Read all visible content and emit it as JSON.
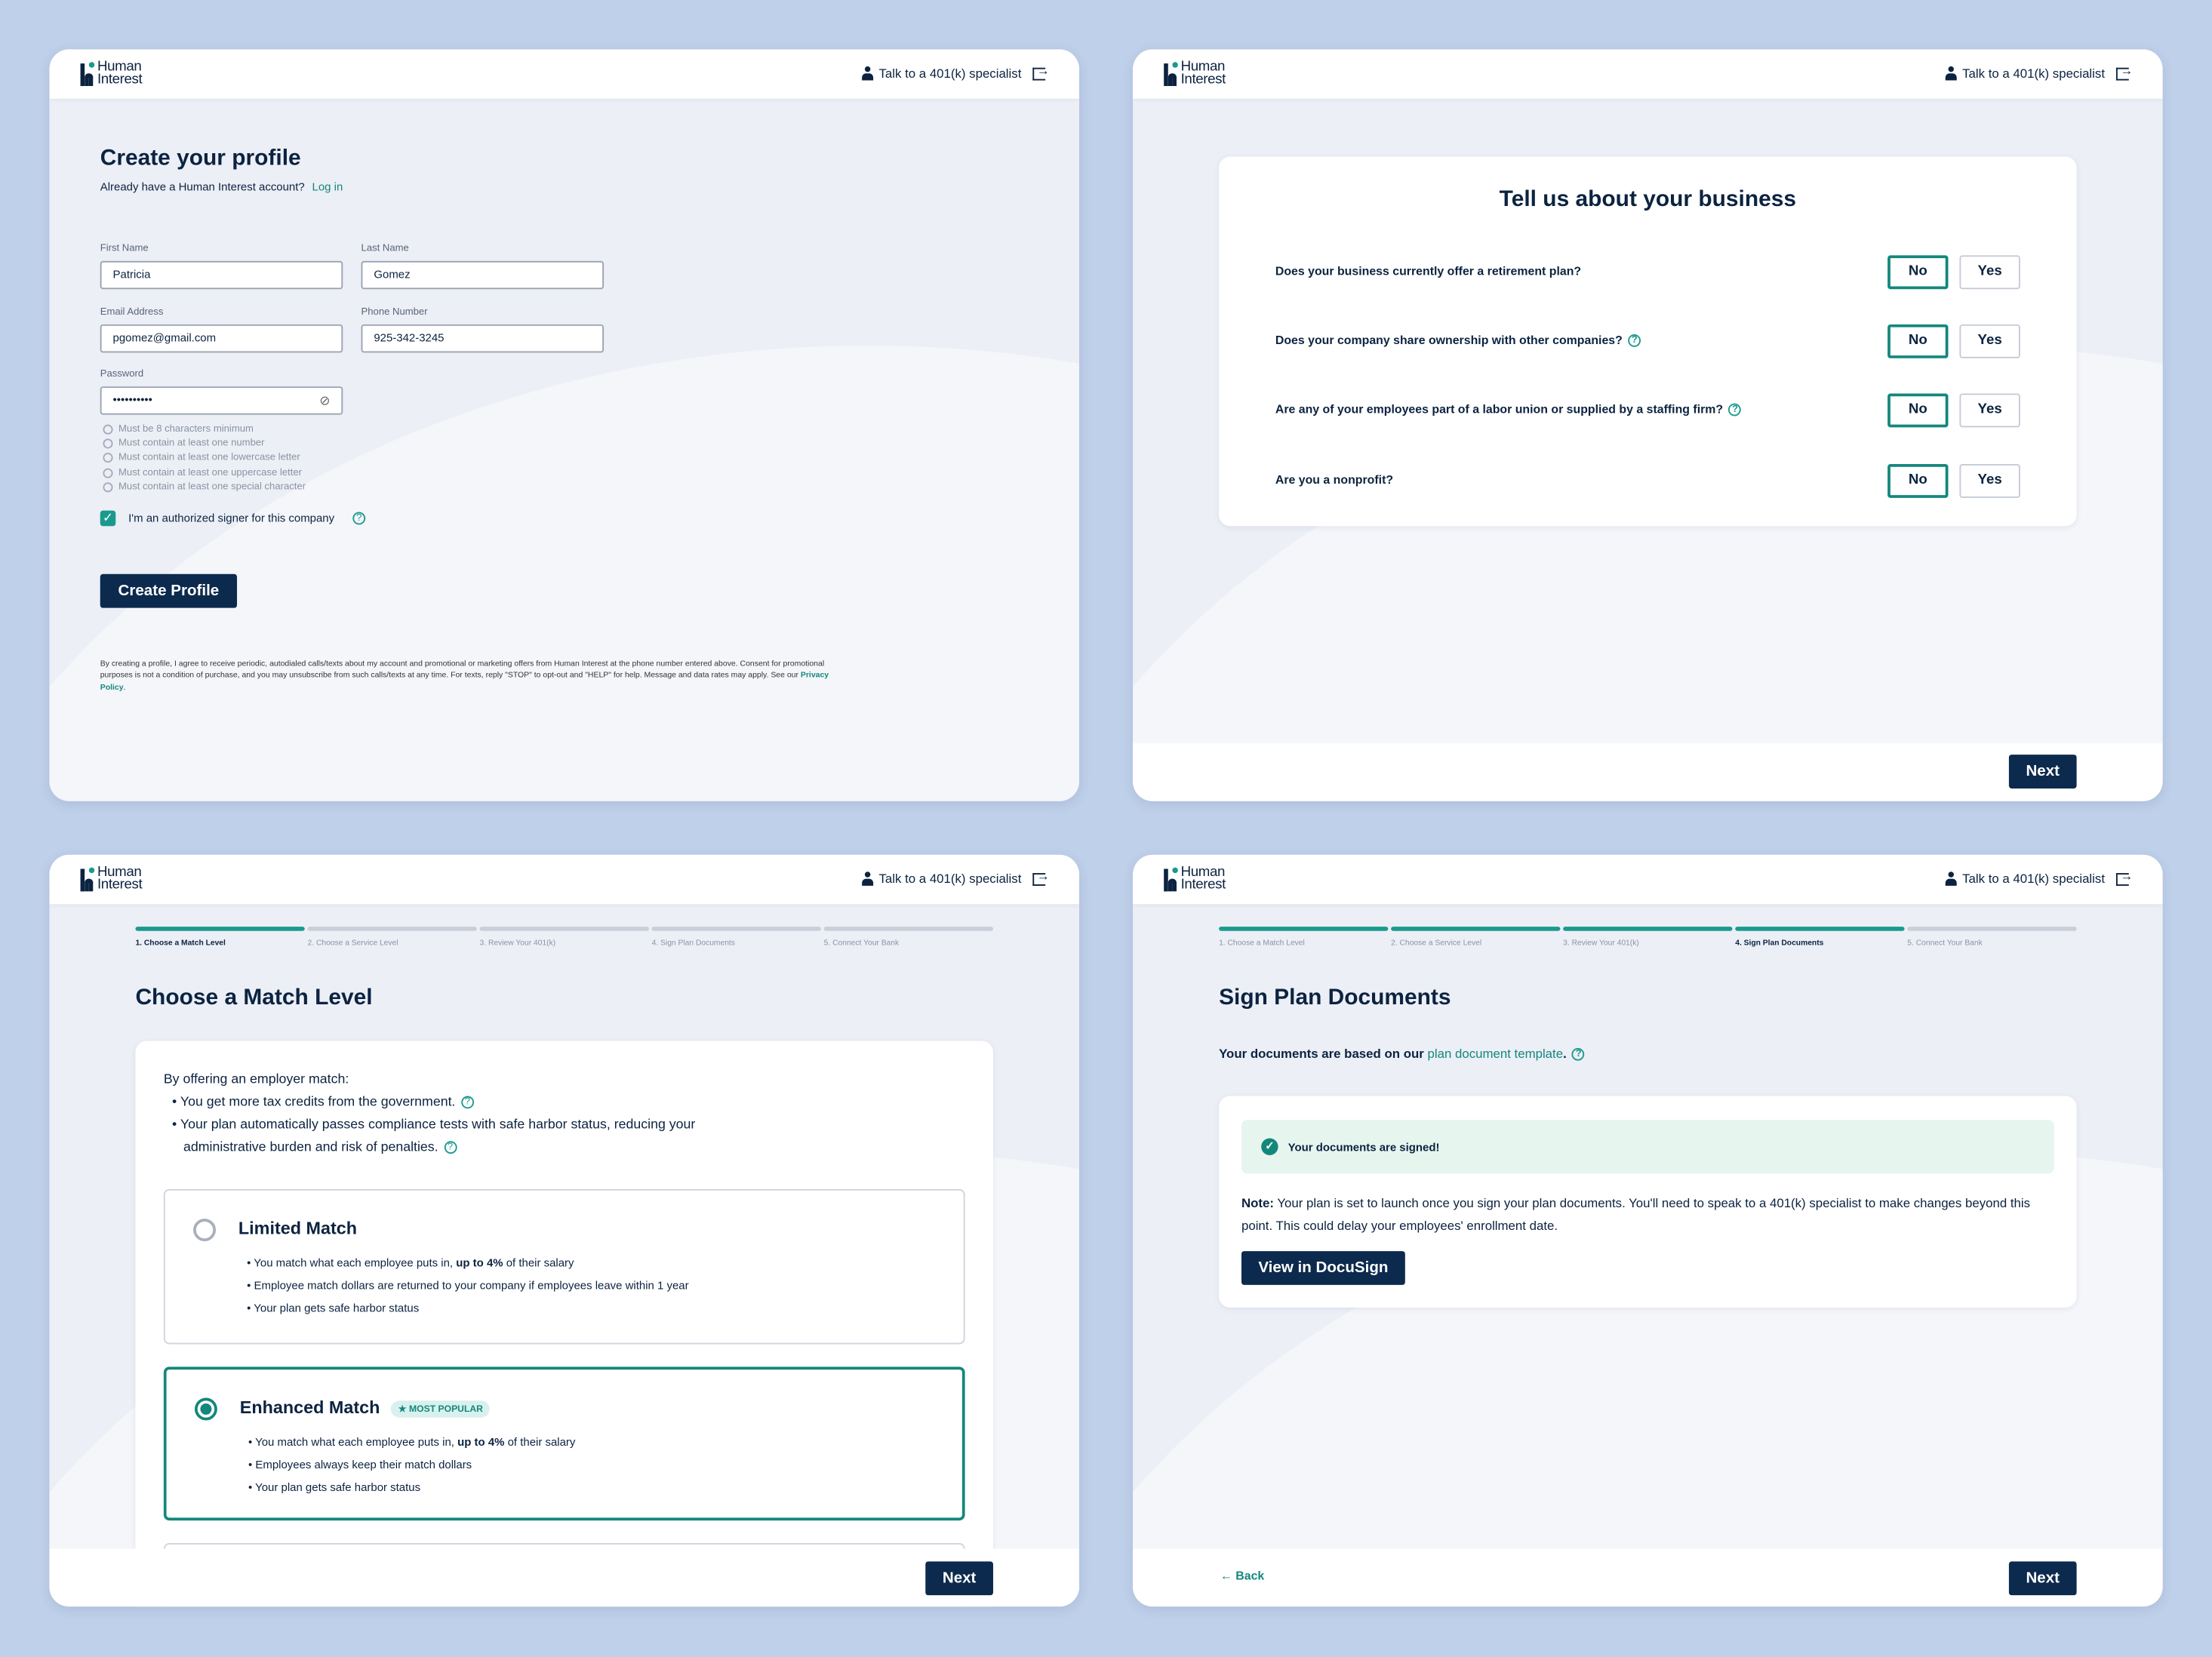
{
  "header": {
    "logo": "Human Interest",
    "specialist_link": "Talk to a 401(k) specialist"
  },
  "colors": {
    "navy": "#0c2a4d",
    "teal": "#14877c",
    "page_bg": "#bfd0ea"
  },
  "profile": {
    "title": "Create your profile",
    "subtitle": "Already have a Human Interest account?",
    "login_link": "Log in",
    "first_name_label": "First Name",
    "first_name": "Patricia",
    "last_name_label": "Last Name",
    "last_name": "Gomez",
    "email_label": "Email Address",
    "email": "pgomez@gmail.com",
    "phone_label": "Phone Number",
    "phone": "925-342-3245",
    "password_label": "Password",
    "password": "••••••••••",
    "rules": [
      "Must be 8 characters minimum",
      "Must contain at least one number",
      "Must contain at least one lowercase letter",
      "Must contain at least one uppercase letter",
      "Must contain at least one special character"
    ],
    "signer_label": "I'm an authorized signer for this company",
    "signer_checked": true,
    "submit": "Create Profile",
    "disclaimer": "By creating a profile, I agree to receive periodic, autodialed calls/texts about my account and promotional or marketing offers from Human Interest at the phone number entered above. Consent for promotional purposes is not a condition of purchase, and you may unsubscribe from such calls/texts at any time. For texts, reply \"STOP\" to opt-out and \"HELP\" for help. Message and data rates may apply. See our",
    "privacy_link": "Privacy Policy"
  },
  "business": {
    "title": "Tell us about your business",
    "questions": [
      {
        "text": "Does your business currently offer a retirement plan?",
        "answer": "No"
      },
      {
        "text": "Does your company share ownership with other companies?",
        "answer": "No"
      },
      {
        "text": "Are any of your employees part of a labor union or supplied by a staffing firm?",
        "answer": "No"
      },
      {
        "text": "Are you a nonprofit?",
        "answer": "No"
      }
    ],
    "no": "No",
    "yes": "Yes",
    "next": "Next"
  },
  "steps": [
    "1. Choose a Match Level",
    "2. Choose a Service Level",
    "3. Review Your 401(k)",
    "4. Sign Plan Documents",
    "5. Connect Your Bank"
  ],
  "match": {
    "current_step": 1,
    "title": "Choose a Match Level",
    "intro": "By offering an employer match:",
    "benefits": [
      "You get more tax credits from the government.",
      "Your plan automatically passes compliance tests with safe harbor status, reducing your administrative burden and risk of penalties."
    ],
    "options": [
      {
        "name": "Limited Match",
        "selected": false,
        "bullets": [
          "You match what each employee puts in, ",
          "up to 4%",
          " of their salary",
          "Employee match dollars are returned to your company if employees leave within 1 year",
          "Your plan gets safe harbor status"
        ]
      },
      {
        "name": "Enhanced Match",
        "selected": true,
        "badge": "MOST POPULAR",
        "bullets": [
          "You match what each employee puts in, ",
          "up to 4%",
          " of their salary",
          "Employees always keep their match dollars",
          "Your plan gets safe harbor status"
        ]
      }
    ],
    "next": "Next"
  },
  "sign": {
    "current_step": 4,
    "title": "Sign Plan Documents",
    "intro": "Your documents are based on our",
    "template_link": "plan document template",
    "intro_end": ".",
    "signed_msg": "Your documents are signed!",
    "note_label": "Note:",
    "note": "Your plan is set to launch once you sign your plan documents. You'll need to speak to a 401(k) specialist to make changes beyond this point. This could delay your employees' enrollment date.",
    "docusign": "View in DocuSign",
    "back": "Back",
    "next": "Next"
  }
}
